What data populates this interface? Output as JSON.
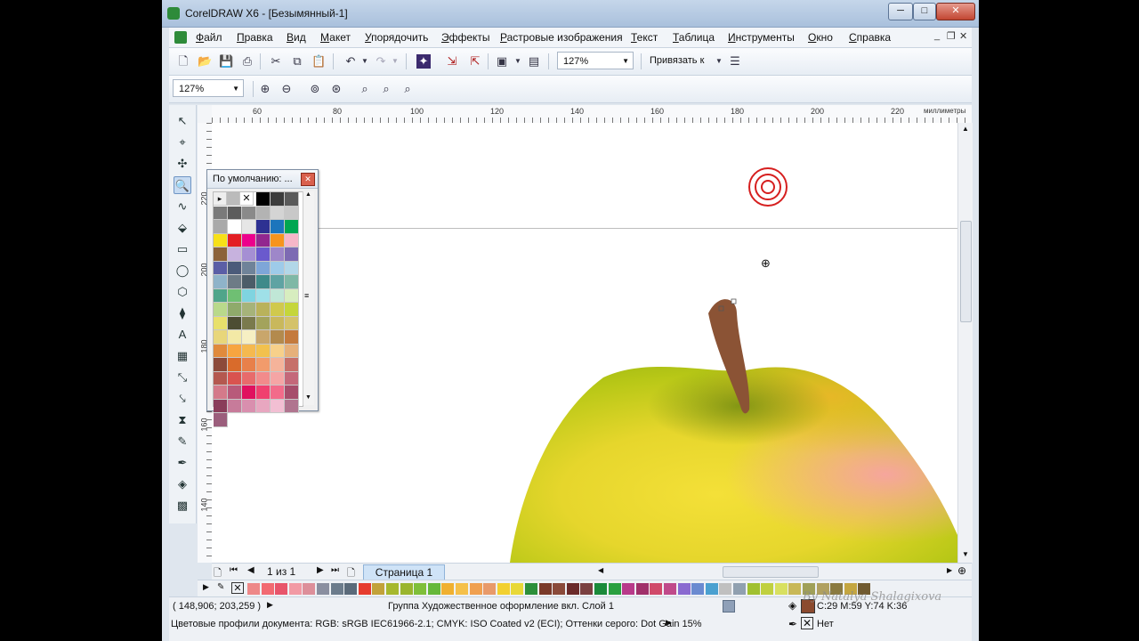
{
  "window": {
    "title": "CorelDRAW X6 - [Безымянный-1]",
    "minimize": "─",
    "maximize": "□",
    "close": "✕"
  },
  "menu": [
    {
      "label": "Файл"
    },
    {
      "label": "Правка"
    },
    {
      "label": "Вид"
    },
    {
      "label": "Макет"
    },
    {
      "label": "Упорядочить"
    },
    {
      "label": "Эффекты"
    },
    {
      "label": "Растровые изображения"
    },
    {
      "label": "Текст"
    },
    {
      "label": "Таблица"
    },
    {
      "label": "Инструменты"
    },
    {
      "label": "Окно"
    },
    {
      "label": "Справка"
    }
  ],
  "toolbar": {
    "zoom_value": "127%",
    "snap_label": "Привязать к"
  },
  "propbar": {
    "zoom_value": "127%"
  },
  "ruler": {
    "units": "миллиметры",
    "h_ticks": [
      "60",
      "80",
      "100",
      "120",
      "140",
      "160",
      "180",
      "200",
      "220"
    ],
    "v_ticks": [
      "220",
      "200",
      "180",
      "160",
      "140"
    ]
  },
  "docker": {
    "title": "По умолчанию: ...",
    "colors": [
      "#000000",
      "#3c3c3c",
      "#5a5a5a",
      "#7a7a7a",
      "#5c5c5c",
      "#8a8a8a",
      "#b3b3b3",
      "#d4d4d4",
      "#c8c8c8",
      "#a9a9a9",
      "#ffffff",
      "#e6e6e6",
      "#2e3192",
      "#1c75bc",
      "#00a651",
      "#f7e018",
      "#e31e24",
      "#ec008c",
      "#92278f",
      "#f7941d",
      "#f6b6c8",
      "#8c6239",
      "#c7b2de",
      "#a58fd3",
      "#6a5acd",
      "#9e87c9",
      "#7d6bb3",
      "#5b5ea6",
      "#4b5b7a",
      "#6f8399",
      "#7ea6d8",
      "#9ecbe9",
      "#b2d7e8",
      "#8fb3c9",
      "#6d7b86",
      "#4c5c68",
      "#3f8a8a",
      "#5fa3a3",
      "#7fb8a6",
      "#4fa58a",
      "#6fbf73",
      "#7fd4e0",
      "#9fe0e8",
      "#c0e7d6",
      "#d7edbf",
      "#b9d98b",
      "#8faa6b",
      "#a6b37a",
      "#b9b25b",
      "#d0c94d",
      "#c5d63a",
      "#e8e06b",
      "#4d4d33",
      "#7a7a4d",
      "#a3a35c",
      "#c9b85c",
      "#d4c26a",
      "#e8d67a",
      "#f3e9a6",
      "#f6efc3",
      "#c9a66b",
      "#b38a4d",
      "#c47a3d",
      "#e08a3c",
      "#f7a540",
      "#f5b94f",
      "#f2c14e",
      "#f7d08a",
      "#e6b07a",
      "#8c4a3a",
      "#d96b2b",
      "#e8804a",
      "#f29b6b",
      "#f5b39a",
      "#c6706a",
      "#b4584f",
      "#d9534f",
      "#e86b6b",
      "#f28b8b",
      "#f5a5a5",
      "#c4687a",
      "#d47a8a",
      "#b85a7a",
      "#e0115f",
      "#f0406f",
      "#f26b8a",
      "#a64d6b",
      "#8a3d5a",
      "#c77b9a",
      "#d98fae",
      "#e8a7c0",
      "#f2bfd3",
      "#b0758f",
      "#9b5e7c"
    ]
  },
  "page": {
    "counter": "1 из 1",
    "tab": "Страница 1"
  },
  "palette": [
    "#ee8888",
    "#f26a72",
    "#e8556b",
    "#f29aa4",
    "#dd8f9a",
    "#8a8fa0",
    "#6c7c8c",
    "#5a6a7a",
    "#e63c2e",
    "#c2a23a",
    "#a6b82e",
    "#9ab52e",
    "#7fbf3a",
    "#66b83a",
    "#f0b030",
    "#f5c04a",
    "#f0a050",
    "#e89a6a",
    "#f2d030",
    "#e8d838",
    "#2c8f3a",
    "#7a3a2a",
    "#8a4a3a",
    "#6a2a2a",
    "#7a4040",
    "#1a8a3a",
    "#2aa040",
    "#b83a8a",
    "#a0306a",
    "#d04a6a",
    "#c04a8a",
    "#8a6ad0",
    "#6a8ad0",
    "#4aa0d0",
    "#c0c0c0",
    "#90a0b0",
    "#a0c030",
    "#c0d040",
    "#d8e060",
    "#c8b858",
    "#a0a058",
    "#b0a060",
    "#8a7a40",
    "#c4a640",
    "#705a30"
  ],
  "status": {
    "coords": "( 148,906; 203,259 )",
    "object_info": "Группа Художественное оформление вкл. Слой 1",
    "fill_values": "C:29 M:59 Y:74 K:36",
    "outline": "Нет",
    "profiles": "Цветовые профили документа: RGB: sRGB IEC61966-2.1; CMYK: ISO Coated v2 (ECI); Оттенки серого: Dot Gain 15%",
    "watermark": "By Natalya Shalagixova",
    "fill_color": "#8b4a2e"
  },
  "colors": {
    "apple_green": "#b9c817",
    "apple_yellow": "#f4e038",
    "apple_pink": "#f7a3a3",
    "stem": "#8b5335",
    "target": "#d61f1f"
  }
}
